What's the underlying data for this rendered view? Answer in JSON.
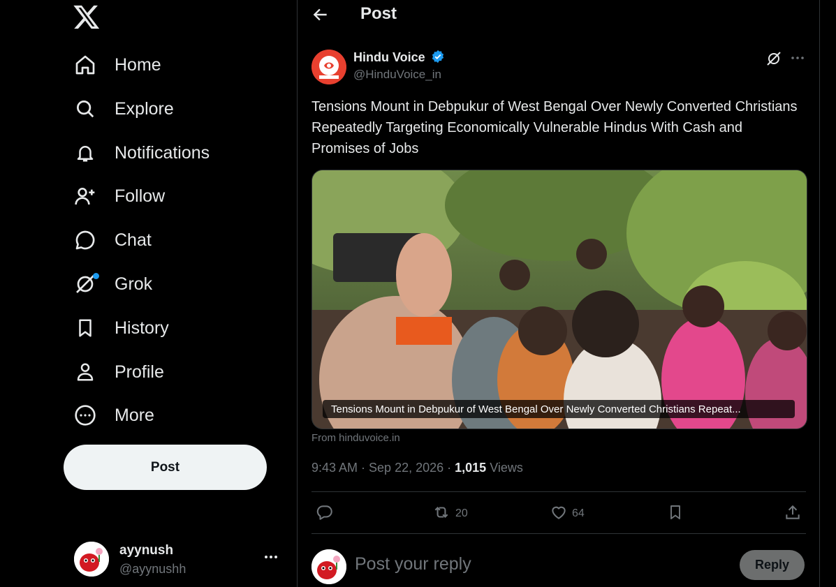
{
  "nav": {
    "items": [
      {
        "label": "Home",
        "icon": "home-icon"
      },
      {
        "label": "Explore",
        "icon": "search-icon"
      },
      {
        "label": "Notifications",
        "icon": "bell-icon"
      },
      {
        "label": "Follow",
        "icon": "follow-icon"
      },
      {
        "label": "Chat",
        "icon": "chat-icon"
      },
      {
        "label": "Grok",
        "icon": "grok-icon"
      },
      {
        "label": "History",
        "icon": "bookmark-icon"
      },
      {
        "label": "Profile",
        "icon": "profile-icon"
      },
      {
        "label": "More",
        "icon": "more-circle-icon"
      }
    ],
    "post_label": "Post"
  },
  "account": {
    "name": "ayynush",
    "handle": "@ayynushh"
  },
  "header": {
    "title": "Post"
  },
  "tweet": {
    "author_name": "Hindu Voice",
    "author_handle": "@HinduVoice_in",
    "text": "Tensions Mount in Debpukur of West Bengal Over Newly Converted Christians Repeatedly Targeting Economically Vulnerable Hindus With Cash and Promises of Jobs",
    "card_title": "Tensions Mount in Debpukur of West Bengal Over Newly Converted Christians Repeat...",
    "from": "From hinduvoice.in",
    "time": "9:43 AM · Sep 22, 2026 · ",
    "views_count": "1,015",
    "views_label": " Views",
    "retweets": "20",
    "likes": "64"
  },
  "reply": {
    "placeholder": "Post your reply",
    "button": "Reply"
  },
  "colors": {
    "accent": "#1d9bf0",
    "background": "#000000",
    "secondary_text": "#71767b",
    "verified": "#1d9bf0"
  }
}
